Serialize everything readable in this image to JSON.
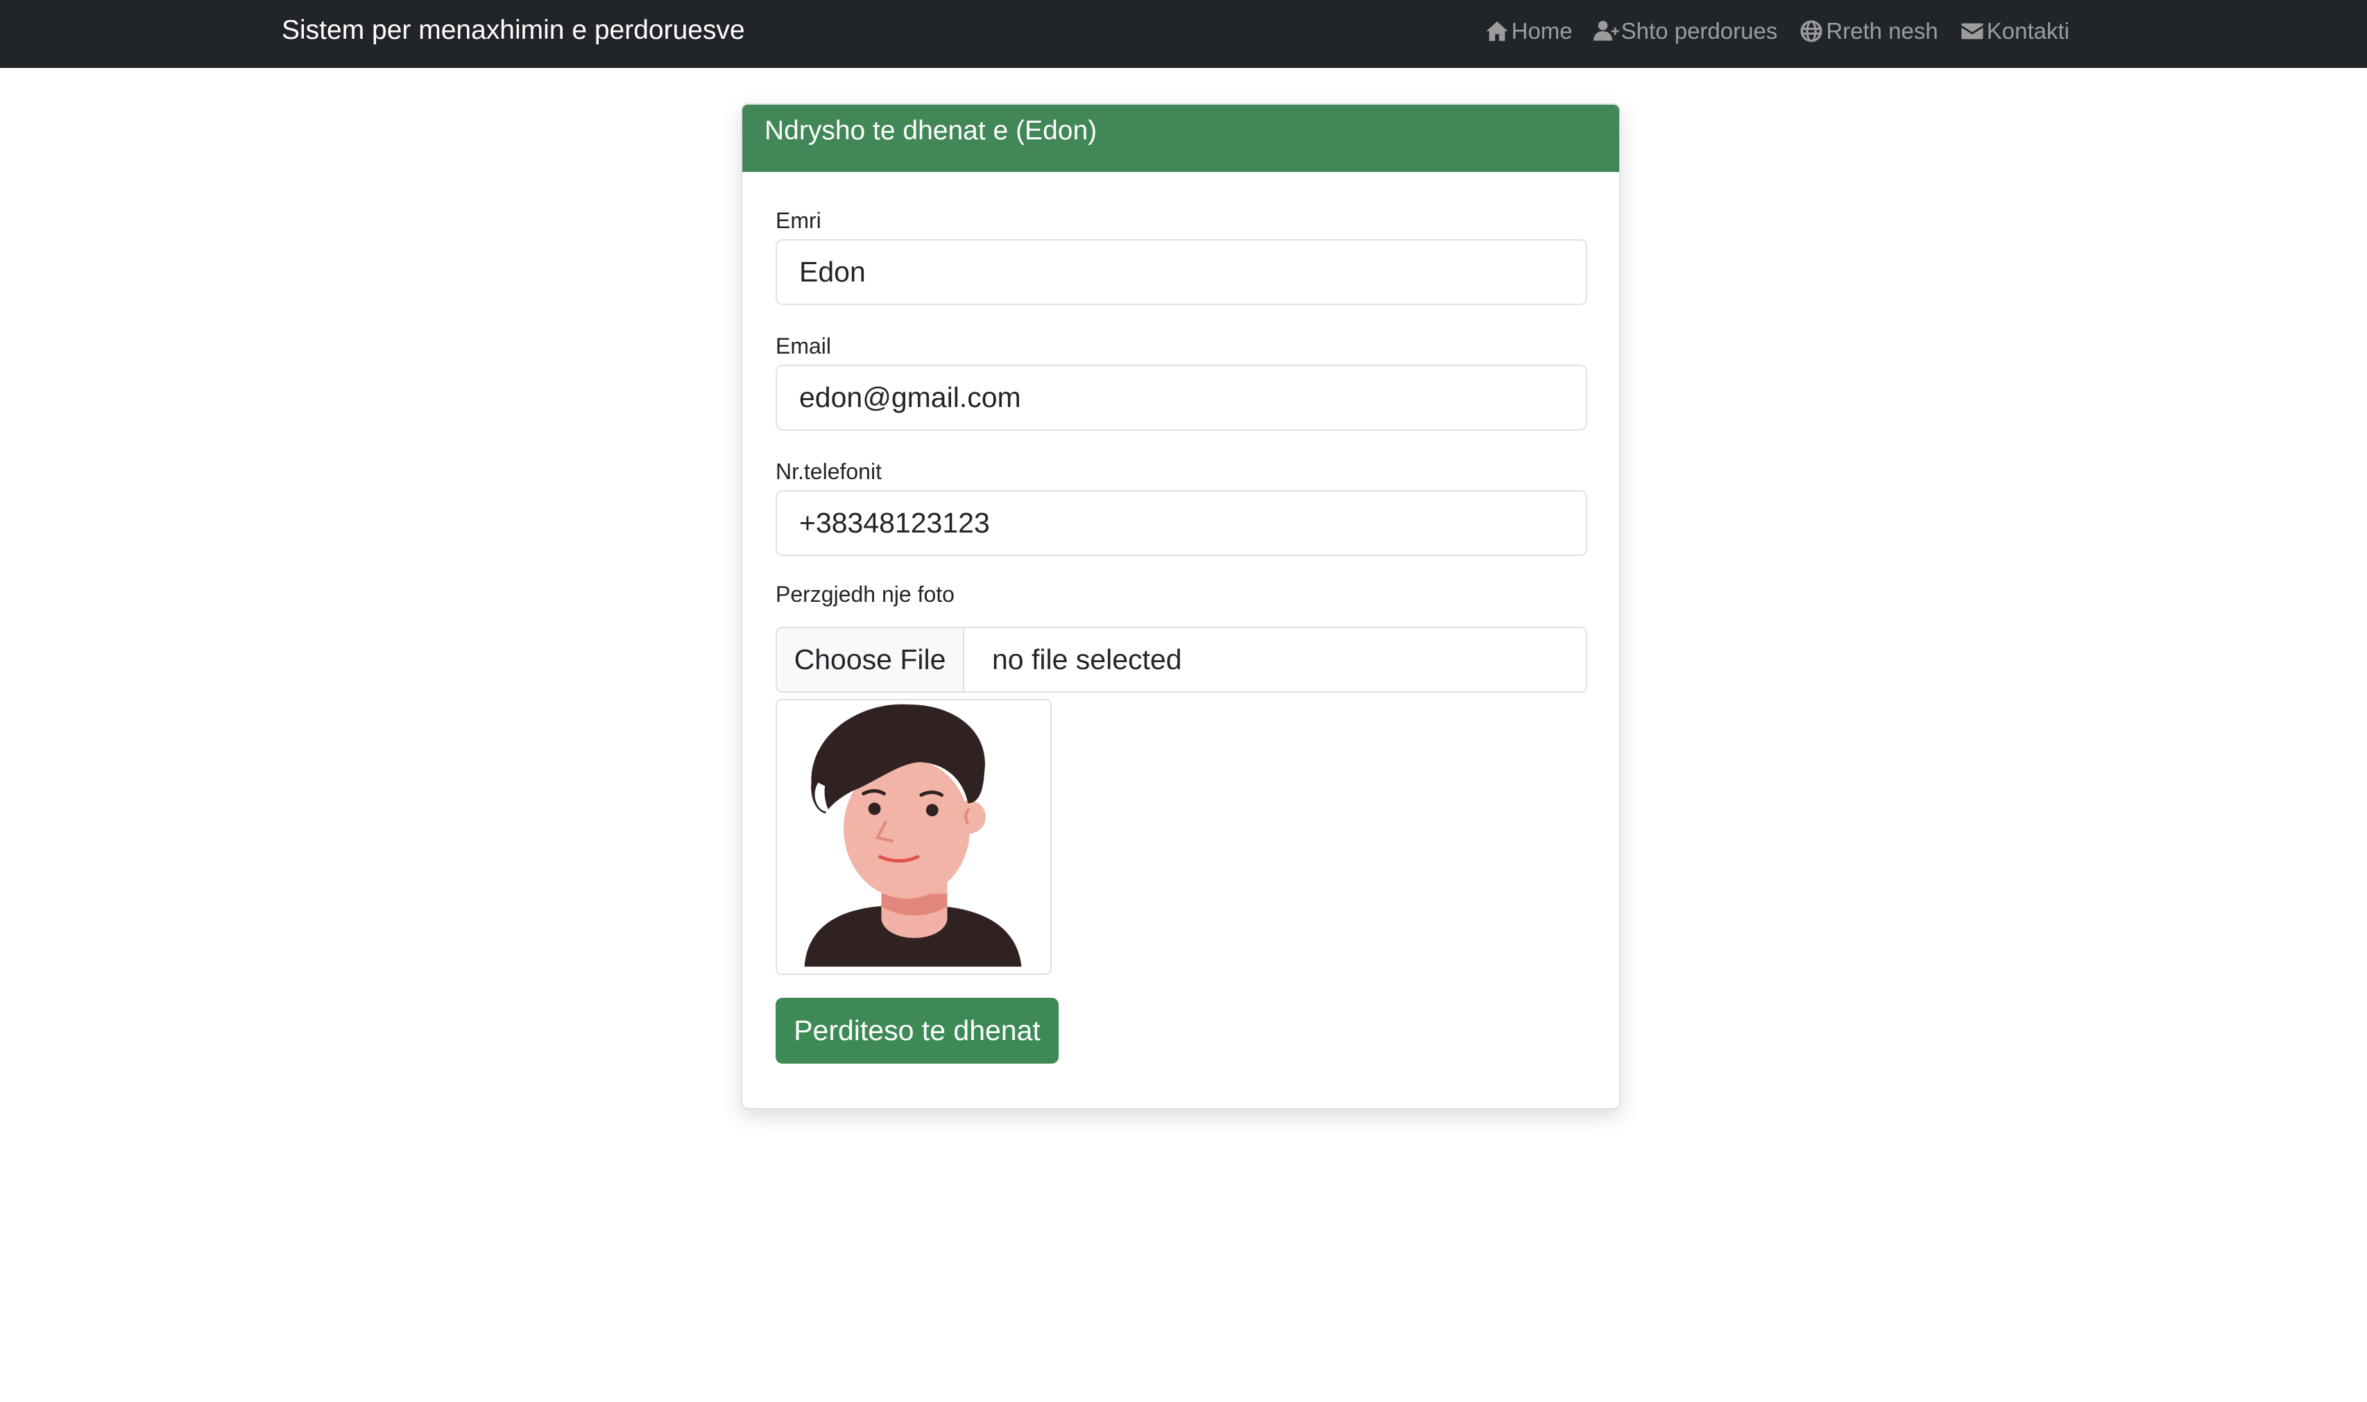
{
  "navbar": {
    "brand": "Sistem per menaxhimin e perdoruesve",
    "links": [
      {
        "label": "Home",
        "icon": "home-icon"
      },
      {
        "label": "Shto perdorues",
        "icon": "user-plus-icon"
      },
      {
        "label": "Rreth nesh",
        "icon": "globe-icon"
      },
      {
        "label": "Kontakti",
        "icon": "envelope-icon"
      }
    ]
  },
  "form": {
    "title": "Ndrysho te dhenat e (Edon)",
    "name": {
      "label": "Emri",
      "value": "Edon"
    },
    "email": {
      "label": "Email",
      "value": "edon@gmail.com"
    },
    "phone": {
      "label": "Nr.telefonit",
      "value": "+38348123123"
    },
    "photo": {
      "label": "Perzgjedh nje foto",
      "button": "Choose File",
      "status": "no file selected"
    },
    "submit_label": "Perditeso te dhenat"
  },
  "colors": {
    "navbar": "#212529",
    "header": "#418757",
    "button": "#3d8a56"
  }
}
